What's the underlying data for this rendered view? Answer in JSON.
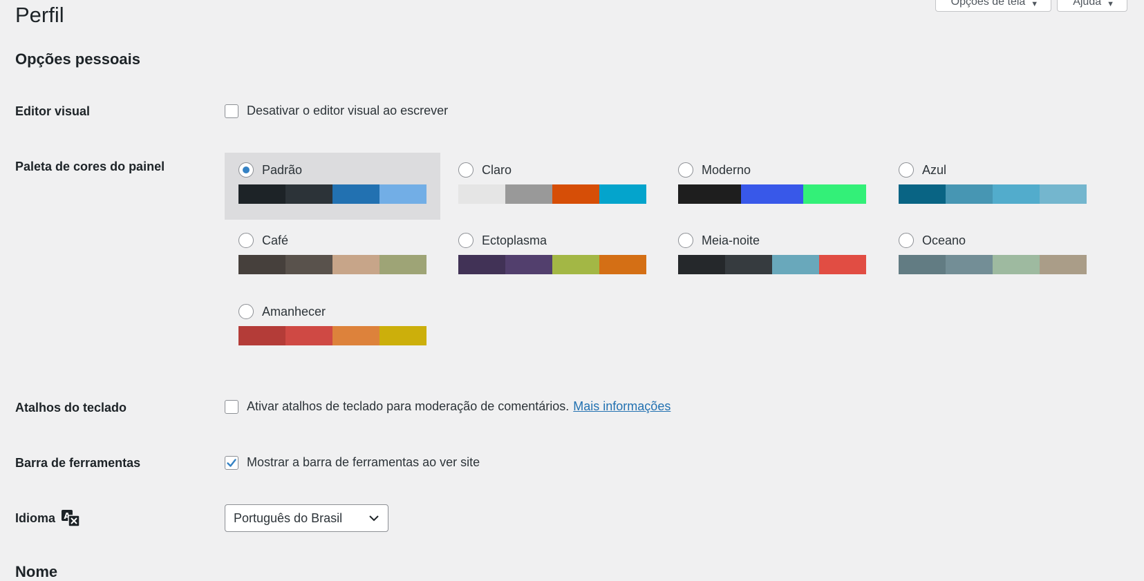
{
  "page": {
    "title": "Perfil",
    "section_title": "Opções pessoais",
    "next_section_title": "Nome"
  },
  "screen_meta": {
    "screen_options_label": "Opções de tela",
    "help_label": "Ajuda"
  },
  "visual_editor": {
    "label": "Editor visual",
    "checkbox_label": "Desativar o editor visual ao escrever",
    "checked": false
  },
  "color_scheme": {
    "label": "Paleta de cores do painel",
    "options": [
      {
        "name": "Padrão",
        "selected": true,
        "colors": [
          "#1d2327",
          "#2c3338",
          "#2271b1",
          "#72aee6"
        ]
      },
      {
        "name": "Claro",
        "selected": false,
        "colors": [
          "#e5e5e5",
          "#999999",
          "#d64e07",
          "#04a4cc"
        ]
      },
      {
        "name": "Moderno",
        "selected": false,
        "colors": [
          "#1e1e1e",
          "#3858e9",
          "#33f078"
        ]
      },
      {
        "name": "Azul",
        "selected": false,
        "colors": [
          "#096484",
          "#4796b3",
          "#52accc",
          "#74b6ce"
        ]
      },
      {
        "name": "Café",
        "selected": false,
        "colors": [
          "#46403c",
          "#59524c",
          "#c7a589",
          "#9ea476"
        ]
      },
      {
        "name": "Ectoplasma",
        "selected": false,
        "colors": [
          "#413256",
          "#523f6d",
          "#a3b745",
          "#d46f15"
        ]
      },
      {
        "name": "Meia-noite",
        "selected": false,
        "colors": [
          "#25282b",
          "#363b3f",
          "#69a8bb",
          "#e14d43"
        ]
      },
      {
        "name": "Oceano",
        "selected": false,
        "colors": [
          "#627c83",
          "#738e96",
          "#9ebaa0",
          "#aa9d88"
        ]
      },
      {
        "name": "Amanhecer",
        "selected": false,
        "colors": [
          "#b43c38",
          "#cf4944",
          "#dd823b",
          "#ccaf0b"
        ]
      }
    ]
  },
  "keyboard_shortcuts": {
    "label": "Atalhos do teclado",
    "checkbox_label": "Ativar atalhos de teclado para moderação de comentários.",
    "link_text": "Mais informações",
    "checked": false
  },
  "toolbar": {
    "label": "Barra de ferramentas",
    "checkbox_label": "Mostrar a barra de ferramentas ao ver site",
    "checked": true
  },
  "language": {
    "label": "Idioma",
    "icon": "translation-icon",
    "selected": "Português do Brasil"
  },
  "colors": {
    "accent": "#2271b1",
    "checkmark": "#3582c4",
    "background": "#f0f0f1"
  }
}
